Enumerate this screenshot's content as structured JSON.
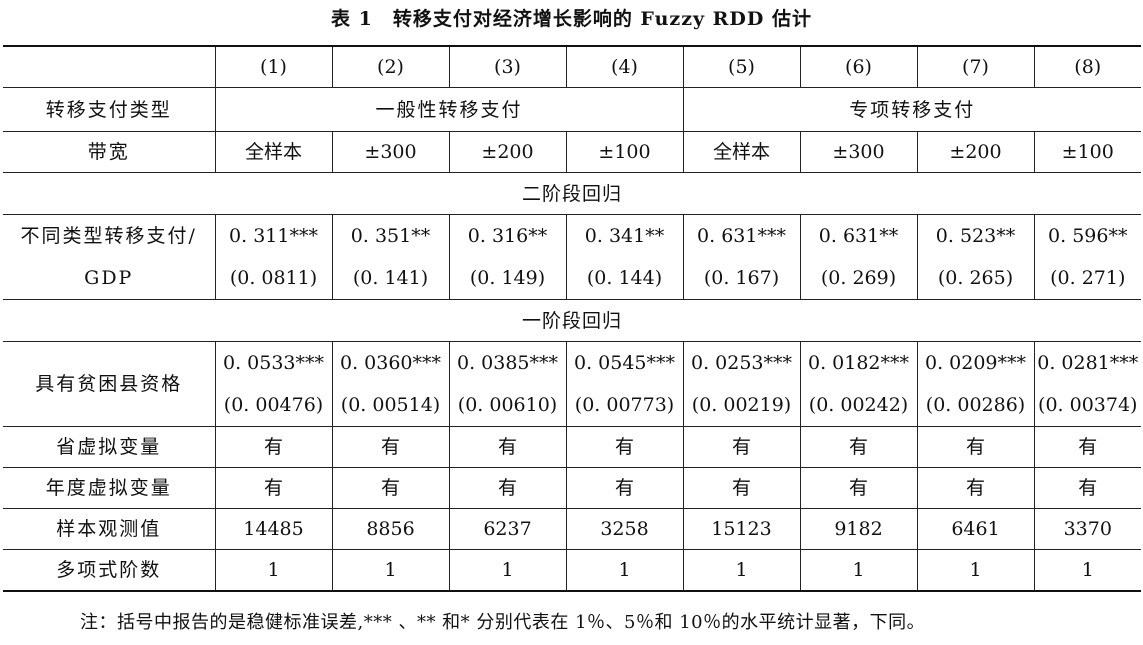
{
  "title": "表 1　转移支付对经济增长影响的 Fuzzy RDD 估计",
  "headers": {
    "columns": [
      "(1)",
      "(2)",
      "(3)",
      "(4)",
      "(5)",
      "(6)",
      "(7)",
      "(8)"
    ],
    "type_label": "转移支付类型",
    "type_general": "一般性转移支付",
    "type_special": "专项转移支付",
    "bandwidth_label": "带宽",
    "bandwidths": [
      "全样本",
      "±300",
      "±200",
      "±100",
      "全样本",
      "±300",
      "±200",
      "±100"
    ]
  },
  "stage2": {
    "section": "二阶段回归",
    "label_line1": "不同类型转移支付/",
    "label_line2": "GDP",
    "coefs": [
      "0. 311***",
      "0. 351**",
      "0. 316**",
      "0. 341**",
      "0. 631***",
      "0. 631**",
      "0. 523**",
      "0. 596**"
    ],
    "ses": [
      "(0. 0811)",
      "(0. 141)",
      "(0. 149)",
      "(0. 144)",
      "(0. 167)",
      "(0. 269)",
      "(0. 265)",
      "(0. 271)"
    ]
  },
  "stage1": {
    "section": "一阶段回归",
    "label": "具有贫困县资格",
    "coefs": [
      "0. 0533***",
      "0. 0360***",
      "0. 0385***",
      "0. 0545***",
      "0. 0253***",
      "0. 0182***",
      "0. 0209***",
      "0. 0281***"
    ],
    "ses": [
      "(0. 00476)",
      "(0. 00514)",
      "(0. 00610)",
      "(0. 00773)",
      "(0. 00219)",
      "(0. 00242)",
      "(0. 00286)",
      "(0. 00374)"
    ]
  },
  "controls": [
    {
      "label": "省虚拟变量",
      "values": [
        "有",
        "有",
        "有",
        "有",
        "有",
        "有",
        "有",
        "有"
      ]
    },
    {
      "label": "年度虚拟变量",
      "values": [
        "有",
        "有",
        "有",
        "有",
        "有",
        "有",
        "有",
        "有"
      ]
    }
  ],
  "obs": {
    "label": "样本观测值",
    "values": [
      "14485",
      "8856",
      "6237",
      "3258",
      "15123",
      "9182",
      "6461",
      "3370"
    ]
  },
  "poly": {
    "label": "多项式阶数",
    "values": [
      "1",
      "1",
      "1",
      "1",
      "1",
      "1",
      "1",
      "1"
    ]
  },
  "note": "注：括号中报告的是稳健标准误差,*** 、** 和* 分别代表在 1％、5％和 10％的水平统计显著，下同。"
}
